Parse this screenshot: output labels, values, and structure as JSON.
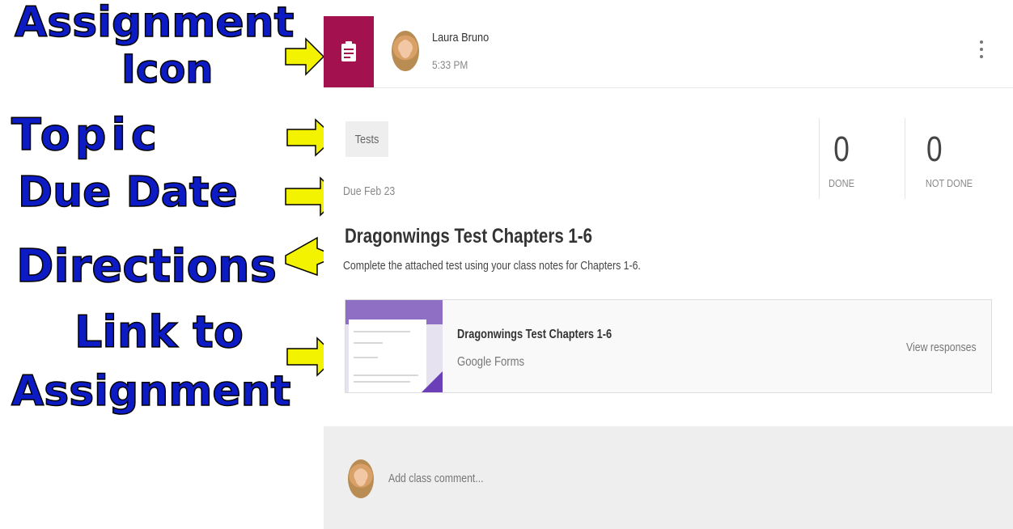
{
  "annotations": {
    "assignment_icon_line1": "Assignment",
    "assignment_icon_line2": "Icon",
    "topic": "Topic",
    "due_date": "Due Date",
    "directions": "Directions",
    "link_line1": "Link to",
    "link_line2": "Assignment"
  },
  "post": {
    "author": "Laura Bruno",
    "time": "5:33 PM",
    "menu_icon": "kebab-menu-icon",
    "assignment_icon": "clipboard-icon",
    "accent_color": "#a4114f"
  },
  "assignment": {
    "topic": "Tests",
    "due": "Due Feb 23",
    "title": "Dragonwings Test Chapters 1-6",
    "directions": "Complete the attached test using your class notes for Chapters 1-6.",
    "stats": [
      {
        "count": "0",
        "label": "DONE"
      },
      {
        "count": "0",
        "label": "NOT DONE"
      }
    ]
  },
  "attachment": {
    "title": "Dragonwings Test Chapters 1-6",
    "source": "Google Forms",
    "action": "View responses"
  },
  "comment": {
    "placeholder": "Add class comment..."
  }
}
